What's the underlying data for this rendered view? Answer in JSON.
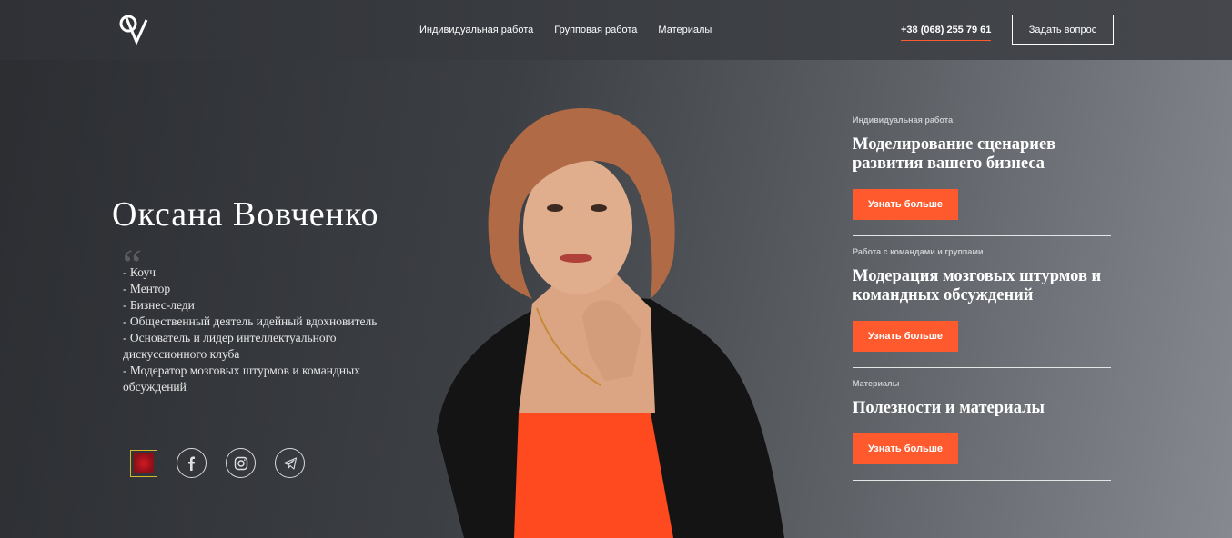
{
  "header": {
    "logo_icon": "ov-monogram-logo",
    "nav": [
      {
        "label": "Индивидуальная работа"
      },
      {
        "label": "Групповая работа"
      },
      {
        "label": "Материалы"
      }
    ],
    "phone": "+38 (068) 255 79 61",
    "ask_button": "Задать вопрос"
  },
  "hero": {
    "name": "Оксана Вовченко",
    "quote_mark": "“",
    "roles": [
      "- Коуч",
      "- Ментор",
      "- Бизнес-леди",
      "- Общественный деятель идейный вдохновитель",
      "- Основатель и лидер интеллектуального дискуссионного клуба",
      "- Модератор мозговых штурмов и командных обсуждений"
    ],
    "socials": [
      {
        "icon": "club-badge-icon"
      },
      {
        "icon": "facebook-icon"
      },
      {
        "icon": "instagram-icon"
      },
      {
        "icon": "telegram-icon"
      }
    ]
  },
  "services": [
    {
      "subtitle": "Индивидуальная работа",
      "title": "Моделирование сценариев развития вашего бизнеса",
      "button": "Узнать больше"
    },
    {
      "subtitle": "Работа с командами и группами",
      "title": "Модерация мозговых штурмов и командных обсуждений",
      "button": "Узнать больше"
    },
    {
      "subtitle": "Материалы",
      "title": "Полезности и материалы",
      "button": "Узнать больше"
    }
  ],
  "colors": {
    "accent": "#ff5a2e",
    "background_dark": "#2b2d31",
    "background_light": "#868990"
  }
}
